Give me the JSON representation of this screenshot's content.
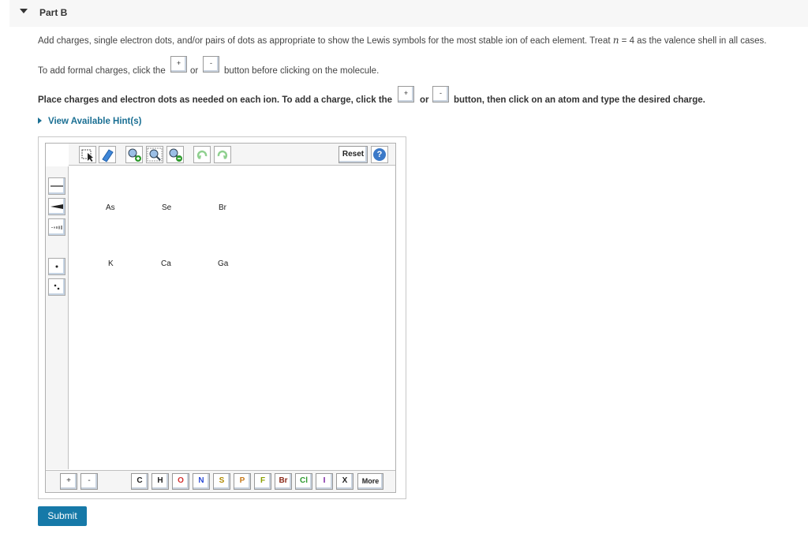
{
  "part": {
    "title": "Part B"
  },
  "instructions": {
    "text_before": "Add charges, single electron dots, and/or pairs of dots as appropriate to show the Lewis symbols for the most stable ion of each element. Treat ",
    "variable": "n",
    "equals": " = 4",
    "text_after": " as the valence shell in all cases."
  },
  "formal_charge": {
    "text_before": "To add formal charges, click the",
    "or": "or",
    "text_after": "button before clicking on the molecule.",
    "plus": "+",
    "minus": "-"
  },
  "place": {
    "text_before": "Place charges and electron dots as needed on each ion. To add a charge, click the",
    "or": "or",
    "text_after": "button, then click on an atom and type the desired charge.",
    "plus": "+",
    "minus": "-"
  },
  "hint": {
    "label": "View Available Hint(s)"
  },
  "editor": {
    "reset_label": "Reset",
    "help_label": "?",
    "top_tools": [
      "select-tool",
      "eraser-tool",
      "zoom-in-tool",
      "zoom-fit-tool",
      "zoom-out-tool",
      "undo-tool",
      "redo-tool"
    ],
    "left_tools": [
      "single-bond-tool",
      "wedge-bond-tool",
      "hash-bond-tool",
      "single-dot-tool",
      "dot-pair-tool"
    ],
    "atoms": [
      {
        "symbol": "As"
      },
      {
        "symbol": "Se"
      },
      {
        "symbol": "Br"
      },
      {
        "symbol": "K"
      },
      {
        "symbol": "Ca"
      },
      {
        "symbol": "Ga"
      }
    ],
    "charge_plus": "+",
    "charge_minus": "-",
    "elements": [
      {
        "symbol": "C",
        "color": "#222222"
      },
      {
        "symbol": "H",
        "color": "#222222"
      },
      {
        "symbol": "O",
        "color": "#d32f2f"
      },
      {
        "symbol": "N",
        "color": "#2b4bd6"
      },
      {
        "symbol": "S",
        "color": "#b08a00"
      },
      {
        "symbol": "P",
        "color": "#c77a1c"
      },
      {
        "symbol": "F",
        "color": "#8aa000"
      },
      {
        "symbol": "Br",
        "color": "#8b2a1a"
      },
      {
        "symbol": "Cl",
        "color": "#2e9a2e"
      },
      {
        "symbol": "I",
        "color": "#7a1fa2"
      },
      {
        "symbol": "X",
        "color": "#222222"
      }
    ],
    "more_label": "More"
  },
  "submit": {
    "label": "Submit"
  }
}
